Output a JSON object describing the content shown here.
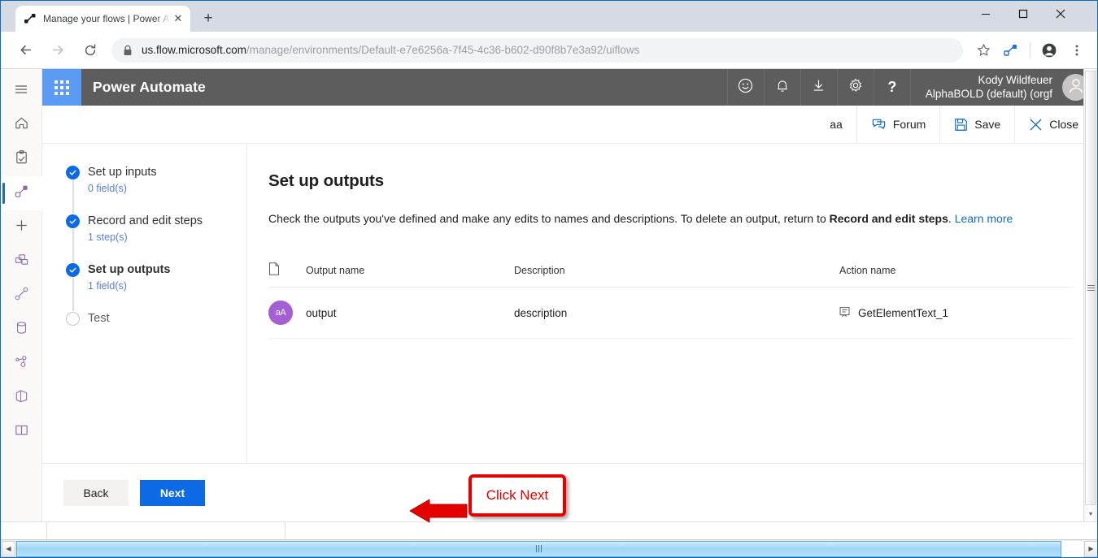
{
  "browser": {
    "tab": {
      "title": "Manage your flows | Power Autom",
      "favicon_icon": "flow-favicon",
      "close_icon": "close-icon"
    },
    "newtab_icon": "plus-icon",
    "window_controls": {
      "minimize_icon": "minimize-icon",
      "maximize_icon": "maximize-icon",
      "close_icon": "window-close-icon"
    },
    "nav": {
      "back_icon": "back-arrow-icon",
      "forward_icon": "forward-arrow-icon",
      "reload_icon": "reload-icon"
    },
    "omnibox": {
      "lock_icon": "lock-icon",
      "url_domain": "us.flow.microsoft.com",
      "url_path": "/manage/environments/Default-e7e6256a-7f45-4c36-b602-d90f8b7e3a92/uiflows"
    },
    "toolbar_icons": [
      "bookmark-star-icon",
      "power-automate-extension-icon",
      "profile-avatar-icon",
      "chrome-menu-icon"
    ]
  },
  "rail": {
    "items": [
      {
        "name": "hamburger-menu",
        "icon": "hamburger-icon"
      },
      {
        "name": "home",
        "icon": "home-icon"
      },
      {
        "name": "action-items",
        "icon": "clipboard-check-icon"
      },
      {
        "name": "my-flows",
        "icon": "flow-icon",
        "selected": true
      },
      {
        "name": "create",
        "icon": "plus-icon"
      },
      {
        "name": "templates",
        "icon": "templates-icon"
      },
      {
        "name": "connectors",
        "icon": "connectors-icon"
      },
      {
        "name": "data",
        "icon": "database-icon"
      },
      {
        "name": "ai-builder",
        "icon": "ai-builder-icon"
      },
      {
        "name": "process-advisor",
        "icon": "process-advisor-icon"
      },
      {
        "name": "learn",
        "icon": "book-icon"
      }
    ]
  },
  "app_header": {
    "waffle_icon": "waffle-grid-icon",
    "brand": "Power Automate",
    "icons": [
      {
        "name": "feedback",
        "icon": "smiley-icon"
      },
      {
        "name": "notifications",
        "icon": "bell-icon"
      },
      {
        "name": "download",
        "icon": "download-icon"
      },
      {
        "name": "settings",
        "icon": "gear-icon"
      },
      {
        "name": "help",
        "icon": "question-mark-icon"
      }
    ],
    "user_name": "Kody Wildfeuer",
    "user_org": "AlphaBOLD (default) (orgf",
    "avatar_icon": "person-avatar-icon"
  },
  "command_bar": {
    "aa_label": "aa",
    "forum_label": "Forum",
    "forum_icon": "chat-icon",
    "save_label": "Save",
    "save_icon": "floppy-disk-icon",
    "close_label": "Close",
    "close_icon": "x-icon"
  },
  "wizard": {
    "steps": [
      {
        "title": "Set up inputs",
        "sub": "0 field(s)",
        "state": "complete",
        "active": false
      },
      {
        "title": "Record and edit steps",
        "sub": "1 step(s)",
        "state": "complete",
        "active": false
      },
      {
        "title": "Set up outputs",
        "sub": "1 field(s)",
        "state": "complete",
        "active": true
      },
      {
        "title": "Test",
        "sub": "",
        "state": "pending",
        "active": false
      }
    ]
  },
  "main": {
    "heading": "Set up outputs",
    "description_part1": "Check the outputs you've defined and make any edits to names and descriptions. To delete an output, return to ",
    "description_bold": "Record and edit steps",
    "description_part2": ".",
    "learn_more": "Learn more",
    "table": {
      "header_icon": "document-icon",
      "columns": [
        "Output name",
        "Description",
        "Action name"
      ],
      "rows": [
        {
          "type_badge": "aA",
          "output_name": "output",
          "description": "description",
          "action_icon": "text-action-icon",
          "action_name": "GetElementText_1"
        }
      ]
    }
  },
  "footer": {
    "back_label": "Back",
    "next_label": "Next"
  },
  "annotation": {
    "text": "Click Next",
    "arrow_icon": "left-arrow-annotation",
    "color": "#e50000"
  },
  "colors": {
    "brand_bar": "#5d5d5d",
    "primary_button": "#0b6ae4",
    "waffle_blue": "#5b9bf3",
    "badge_purple": "#a55fd4",
    "link_blue": "#0f6cbd",
    "step_sub_blue": "#5b7fd4"
  }
}
